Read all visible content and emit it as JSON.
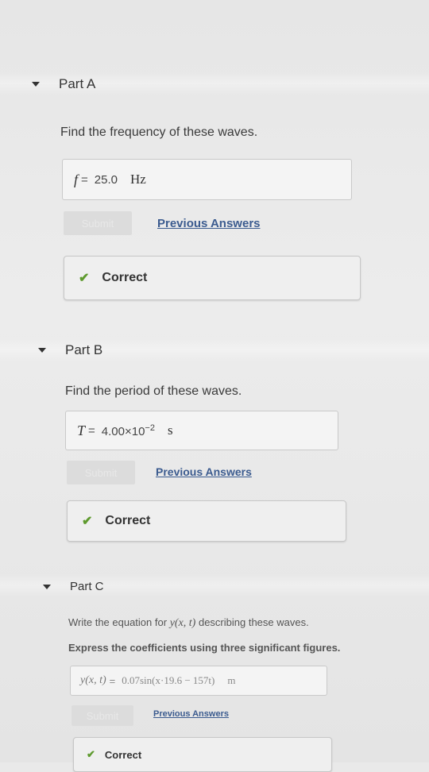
{
  "parts": [
    {
      "title": "Part A",
      "question": "Find the frequency of these waves.",
      "answer": {
        "variable": "f",
        "equals": "=",
        "value": "25.0",
        "unit": "Hz"
      },
      "submit_label": "Submit",
      "previous_answers": "Previous Answers",
      "status": "Correct"
    },
    {
      "title": "Part B",
      "question": "Find the period of these waves.",
      "answer": {
        "variable": "T",
        "equals": "=",
        "value": "4.00×10",
        "exponent": "−2",
        "unit": "s"
      },
      "submit_label": "Submit",
      "previous_answers": "Previous Answers",
      "status": "Correct"
    },
    {
      "title": "Part C",
      "question_prefix": "Write the equation for",
      "question_math": "y(x, t)",
      "question_suffix": "describing these waves.",
      "instruction": "Express the coefficients using three significant figures.",
      "answer": {
        "variable": "y(x, t)",
        "equals": "=",
        "value": "0.07sin(x·19.6 − 157t)",
        "unit": "m"
      },
      "submit_label": "Submit",
      "previous_answers": "Previous Answers",
      "status": "Correct"
    }
  ],
  "colors": {
    "link": "#3b5b8f",
    "check": "#5e9a2e"
  },
  "icons": {
    "collapse": "caret-down-icon",
    "status": "checkmark-icon"
  }
}
